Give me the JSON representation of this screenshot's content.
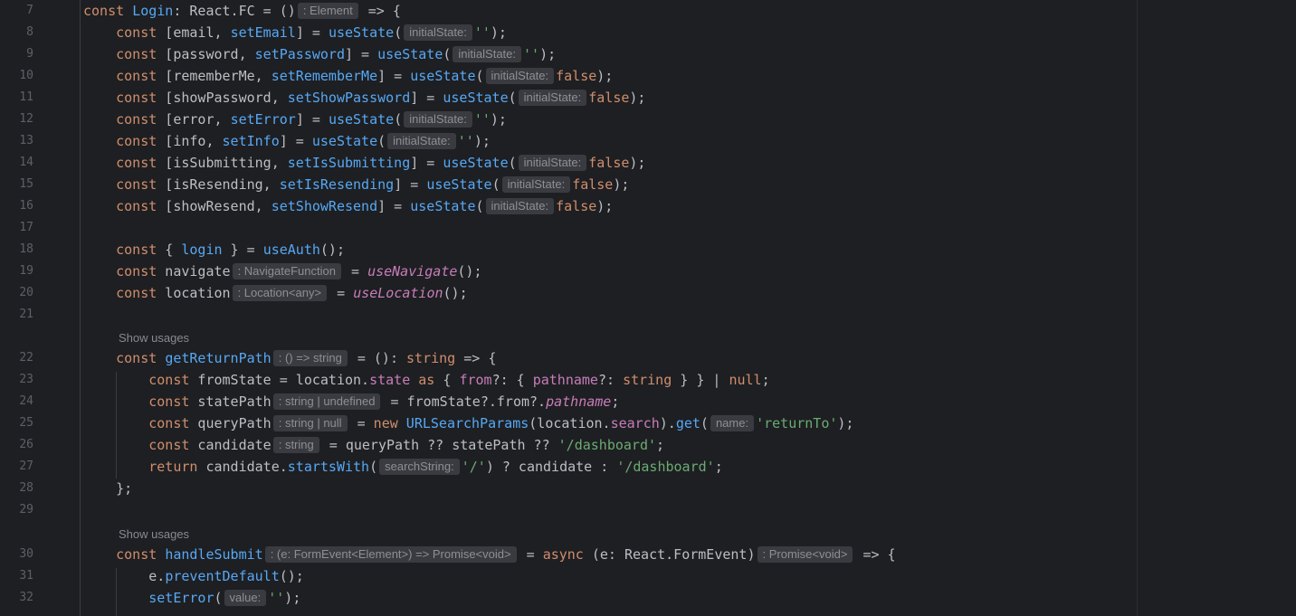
{
  "editor": {
    "line_numbers": [
      "7",
      "8",
      "9",
      "10",
      "11",
      "12",
      "13",
      "14",
      "15",
      "16",
      "17",
      "18",
      "19",
      "20",
      "21",
      "22",
      "23",
      "24",
      "25",
      "26",
      "27",
      "28",
      "29",
      "30",
      "31",
      "32"
    ],
    "usages_label": "Show usages",
    "hints": {
      "element": ": Element",
      "initial_state": "initialState:",
      "navigate_fn": ": NavigateFunction",
      "location_any": ": Location<any>",
      "return_path": ": () => string",
      "string_undefined": ": string | undefined",
      "string_null": ": string | null",
      "name": "name:",
      "string": ": string",
      "search_string": "searchString:",
      "handle_submit": ": (e: FormEvent<Element>) => Promise<void>",
      "promise_void": ": Promise<void>",
      "value": "value:"
    }
  }
}
